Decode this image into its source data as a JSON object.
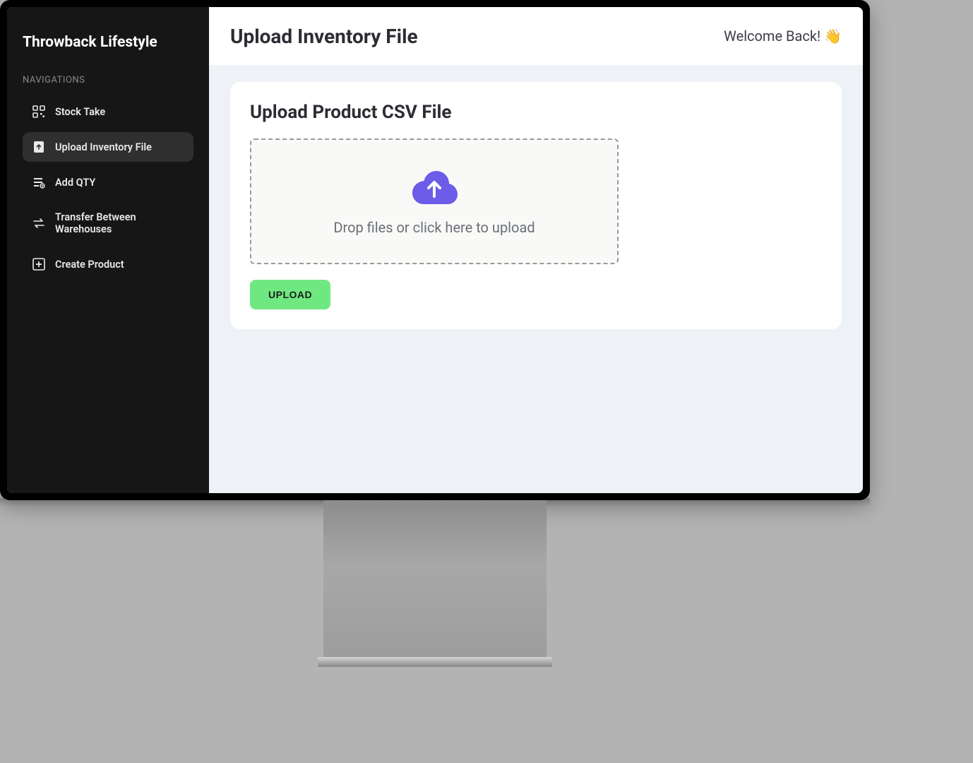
{
  "sidebar": {
    "brand": "Throwback Lifestyle",
    "section_label": "NAVIGATIONS",
    "items": [
      {
        "label": "Stock Take",
        "icon": "qr-icon",
        "active": false
      },
      {
        "label": "Upload Inventory File",
        "icon": "upload-file-icon",
        "active": true
      },
      {
        "label": "Add QTY",
        "icon": "add-qty-icon",
        "active": false
      },
      {
        "label": "Transfer Between Warehouses",
        "icon": "transfer-icon",
        "active": false
      },
      {
        "label": "Create Product",
        "icon": "plus-icon",
        "active": false
      }
    ]
  },
  "header": {
    "title": "Upload Inventory File",
    "welcome": "Welcome Back! 👋"
  },
  "main": {
    "card_title": "Upload Product CSV File",
    "dropzone_text": "Drop files or click here to upload",
    "upload_button": "UPLOAD"
  }
}
